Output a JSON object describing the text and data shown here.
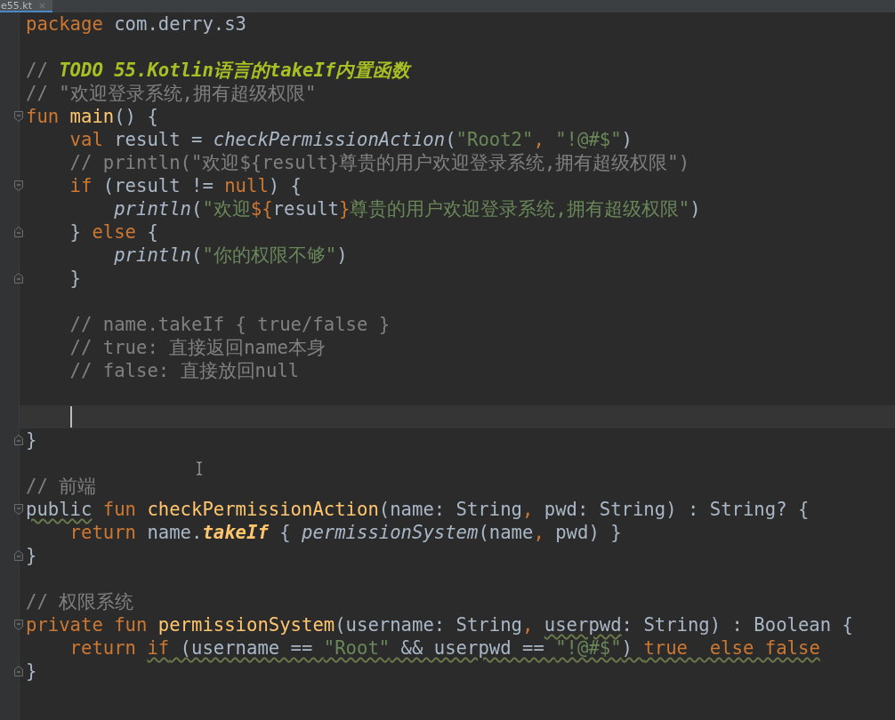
{
  "tab": {
    "label": "e55.kt"
  },
  "lines": [
    {
      "kind": "code",
      "tokens": [
        {
          "text": "package",
          "kind": "kw"
        },
        {
          "text": " com.derry.s3",
          "kind": "plain"
        }
      ]
    },
    {
      "kind": "blank"
    },
    {
      "kind": "code",
      "tokens": [
        {
          "text": "// ",
          "kind": "comment"
        },
        {
          "text": "TODO 55.Kotlin语言的takeIf内置函数",
          "kind": "todo"
        }
      ]
    },
    {
      "kind": "code",
      "tokens": [
        {
          "text": "// \"欢迎登录系统,拥有超级权限\"",
          "kind": "comment"
        }
      ]
    },
    {
      "kind": "open",
      "tokens": [
        {
          "text": "fun ",
          "kind": "kw"
        },
        {
          "text": "main",
          "kind": "fn"
        },
        {
          "text": "() {",
          "kind": "plain"
        }
      ],
      "children": [
        {
          "kind": "code",
          "tokens": [
            {
              "text": "val ",
              "kind": "kw"
            },
            {
              "text": "result = ",
              "kind": "plain"
            },
            {
              "text": "checkPermissionAction",
              "kind": "call"
            },
            {
              "text": "(",
              "kind": "plain"
            },
            {
              "text": "\"Root2\"",
              "kind": "str"
            },
            {
              "text": ", ",
              "kind": "kw"
            },
            {
              "text": "\"!@#$\"",
              "kind": "str"
            },
            {
              "text": ")",
              "kind": "plain"
            }
          ]
        },
        {
          "kind": "code",
          "tokens": [
            {
              "text": "// println(\"欢迎${result}尊贵的用户欢迎登录系统,拥有超级权限\")",
              "kind": "comment"
            }
          ]
        },
        {
          "kind": "open",
          "tokens": [
            {
              "text": "if ",
              "kind": "kw"
            },
            {
              "text": "(result != ",
              "kind": "plain"
            },
            {
              "text": "null",
              "kind": "kw"
            },
            {
              "text": ") {",
              "kind": "plain"
            }
          ],
          "children": [
            {
              "kind": "code",
              "tokens": [
                {
                  "text": "println",
                  "kind": "call"
                },
                {
                  "text": "(",
                  "kind": "plain"
                },
                {
                  "text": "\"欢迎",
                  "kind": "str"
                },
                {
                  "text": "${",
                  "kind": "kw"
                },
                {
                  "text": "result",
                  "kind": "plain"
                },
                {
                  "text": "}",
                  "kind": "kw"
                },
                {
                  "text": "尊贵的用户欢迎登录系统,拥有超级权限\"",
                  "kind": "str"
                },
                {
                  "text": ")",
                  "kind": "plain"
                }
              ]
            }
          ]
        },
        {
          "kind": "close",
          "tokens": [
            {
              "text": "} ",
              "kind": "plain"
            },
            {
              "text": "else",
              "kind": "kw"
            },
            {
              "text": " {",
              "kind": "plain"
            }
          ],
          "children": [
            {
              "kind": "code",
              "tokens": [
                {
                  "text": "println",
                  "kind": "call"
                },
                {
                  "text": "(",
                  "kind": "plain"
                },
                {
                  "text": "\"你的权限不够\"",
                  "kind": "str"
                },
                {
                  "text": ")",
                  "kind": "plain"
                }
              ]
            }
          ]
        },
        {
          "kind": "close",
          "tokens": [
            {
              "text": "}",
              "kind": "plain"
            }
          ]
        },
        {
          "kind": "blank"
        },
        {
          "kind": "code",
          "tokens": [
            {
              "text": "// name.takeIf { true/false }",
              "kind": "comment"
            }
          ]
        },
        {
          "kind": "code",
          "tokens": [
            {
              "text": "// true: 直接返回name本身",
              "kind": "comment"
            }
          ]
        },
        {
          "kind": "code",
          "tokens": [
            {
              "text": "// false: 直接放回null",
              "kind": "comment"
            }
          ]
        },
        {
          "kind": "blank"
        },
        {
          "kind": "blank",
          "current": true
        }
      ]
    },
    {
      "kind": "close",
      "tokens": [
        {
          "text": "}",
          "kind": "plain"
        }
      ]
    },
    {
      "kind": "blank"
    },
    {
      "kind": "code",
      "tokens": [
        {
          "text": "// 前端",
          "kind": "comment"
        }
      ]
    },
    {
      "kind": "open",
      "tokens": [
        {
          "text": "public",
          "kind": "plain-warn"
        },
        {
          "text": " fun ",
          "kind": "kw"
        },
        {
          "text": "checkPermissionAction",
          "kind": "fn"
        },
        {
          "text": "(name: String",
          "kind": "plain"
        },
        {
          "text": ", ",
          "kind": "kw"
        },
        {
          "text": "pwd: String) : String? {",
          "kind": "plain"
        }
      ],
      "children": [
        {
          "kind": "code",
          "tokens": [
            {
              "text": "return ",
              "kind": "kw"
            },
            {
              "text": "name.",
              "kind": "plain"
            },
            {
              "text": "takeIf",
              "kind": "ext"
            },
            {
              "text": " { ",
              "kind": "plain"
            },
            {
              "text": "permissionSystem",
              "kind": "call"
            },
            {
              "text": "(name",
              "kind": "plain"
            },
            {
              "text": ", ",
              "kind": "kw"
            },
            {
              "text": "pwd) }",
              "kind": "plain"
            }
          ]
        }
      ]
    },
    {
      "kind": "close",
      "tokens": [
        {
          "text": "}",
          "kind": "plain"
        }
      ]
    },
    {
      "kind": "blank"
    },
    {
      "kind": "code",
      "tokens": [
        {
          "text": "// 权限系统",
          "kind": "comment"
        }
      ]
    },
    {
      "kind": "open",
      "tokens": [
        {
          "text": "private fun ",
          "kind": "kw"
        },
        {
          "text": "permissionSystem",
          "kind": "fn"
        },
        {
          "text": "(username: String",
          "kind": "plain"
        },
        {
          "text": ", ",
          "kind": "kw"
        },
        {
          "text": "userpwd",
          "kind": "plain-warn"
        },
        {
          "text": ": String) : Boolean {",
          "kind": "plain"
        }
      ],
      "children": [
        {
          "kind": "code",
          "tokens": [
            {
              "text": "return ",
              "kind": "kw"
            },
            {
              "text": "if",
              "kind": "kw-warn"
            },
            {
              "text": " (username == ",
              "kind": "plain-warn"
            },
            {
              "text": "\"Root\"",
              "kind": "str-warn"
            },
            {
              "text": " && userpwd == ",
              "kind": "plain-warn"
            },
            {
              "text": "\"!@#$\"",
              "kind": "str-warn"
            },
            {
              "text": ") ",
              "kind": "plain-warn"
            },
            {
              "text": "true  else false",
              "kind": "kw-warn"
            }
          ]
        }
      ]
    },
    {
      "kind": "close",
      "tokens": [
        {
          "text": "}",
          "kind": "plain"
        }
      ]
    }
  ]
}
